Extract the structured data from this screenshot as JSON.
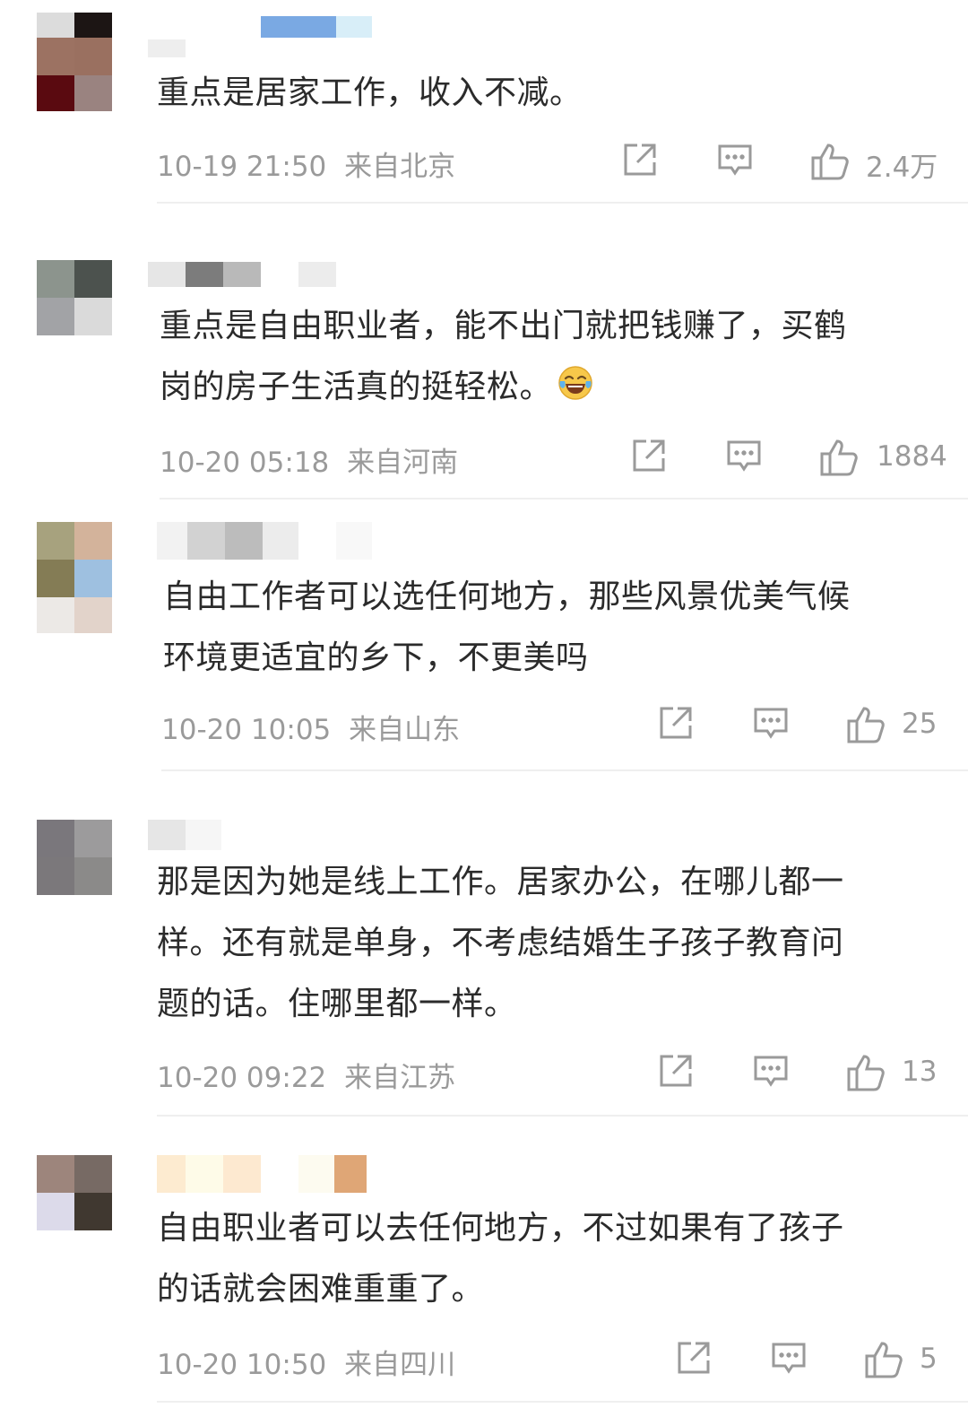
{
  "comments": [
    {
      "text_lines": [
        "重点是居家工作，收入不减。"
      ],
      "time": "10-19 21:50",
      "location": "来自北京",
      "likes": "2.4万",
      "avatar_colors": [
        "#dcdcdc",
        "#1c1514",
        "#9c7262",
        "#9a7060",
        "#5a0a10",
        "#9a8380"
      ],
      "name_colors": [
        "#eeeeee",
        "#7aa9e3",
        "#d8eef8"
      ]
    },
    {
      "text_lines": [
        "重点是自由职业者，能不出门就把钱赚了，买鹤",
        "岗的房子生活真的挺轻松。"
      ],
      "emoji": "laughing-tears",
      "time": "10-20 05:18",
      "location": "来自河南",
      "likes": "1884",
      "avatar_colors": [
        "#8c948d",
        "#4c524e",
        "#a2a3a6",
        "#dadada"
      ],
      "name_colors": [
        "#e6e6e6",
        "#7c7c7c",
        "#b9b9b9",
        "#ececec"
      ]
    },
    {
      "text_lines": [
        "自由工作者可以选任何地方，那些风景优美气候",
        "环境更适宜的乡下，不更美吗"
      ],
      "time": "10-20 10:05",
      "location": "来自山东",
      "likes": "25",
      "avatar_colors": [
        "#a7a27e",
        "#d3b39b",
        "#847c55",
        "#9ec0e0",
        "#ece9e6",
        "#e2d3ca"
      ],
      "name_colors": [
        "#f2f2f2",
        "#d2d2d2",
        "#bcbcbc",
        "#ececec",
        "#f8f8f8"
      ]
    },
    {
      "text_lines": [
        "那是因为她是线上工作。居家办公，在哪儿都一",
        "样。还有就是单身，不考虑结婚生子孩子教育问",
        "题的话。住哪里都一样。"
      ],
      "time": "10-20 09:22",
      "location": "来自江苏",
      "likes": "13",
      "avatar_colors": [
        "#7a777c",
        "#9c9b9c",
        "#7b787b",
        "#8b8a89"
      ],
      "name_colors": [
        "#e6e6e6",
        "#f6f6f6"
      ]
    },
    {
      "text_lines": [
        "自由职业者可以去任何地方，不过如果有了孩子",
        "的话就会困难重重了。"
      ],
      "time": "10-20 10:50",
      "location": "来自四川",
      "likes": "5",
      "avatar_colors": [
        "#9d857c",
        "#776a64",
        "#dcdaea",
        "#403830"
      ],
      "name_colors": [
        "#fdebd0",
        "#fefbe8",
        "#fde9d0",
        "#fdfbf0",
        "#dfa676"
      ]
    }
  ],
  "icons": {
    "share": "share-icon",
    "reply": "comment-icon",
    "like": "thumbs-up-icon"
  }
}
